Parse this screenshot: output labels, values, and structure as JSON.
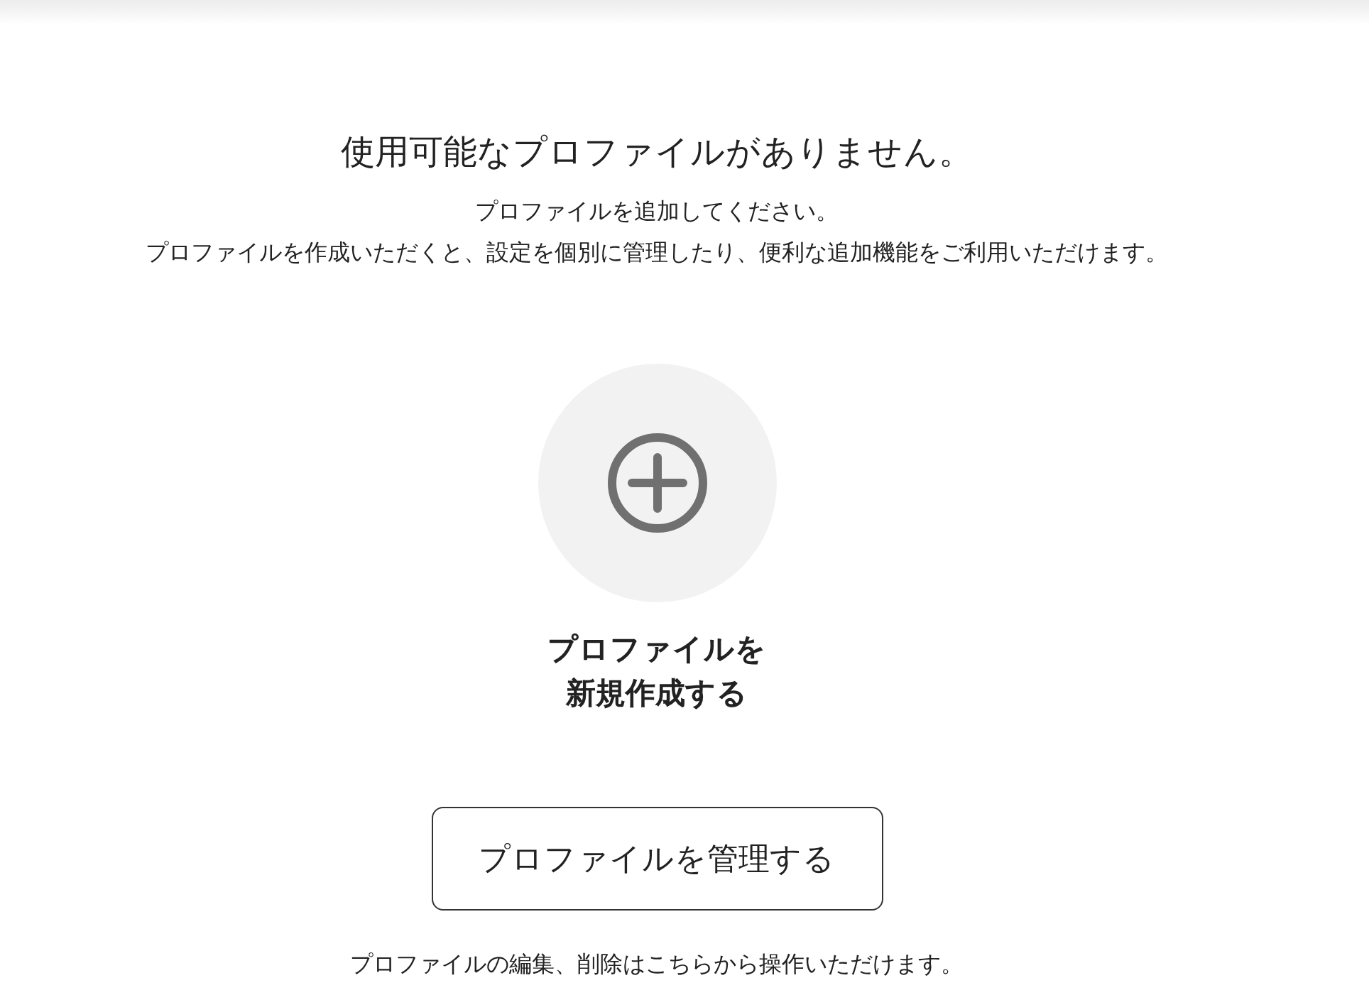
{
  "title": "使用可能なプロファイルがありません。",
  "description": [
    "プロファイルを追加してください。",
    "プロファイルを作成いただくと、設定を個別に管理したり、便利な追加機能をご利用いただけます。"
  ],
  "create_profile": {
    "label_lines": [
      "プロファイルを",
      "新規作成する"
    ]
  },
  "manage_button": {
    "label": "プロファイルを管理する"
  },
  "footer_note": "プロファイルの編集、削除はこちらから操作いただけます。"
}
